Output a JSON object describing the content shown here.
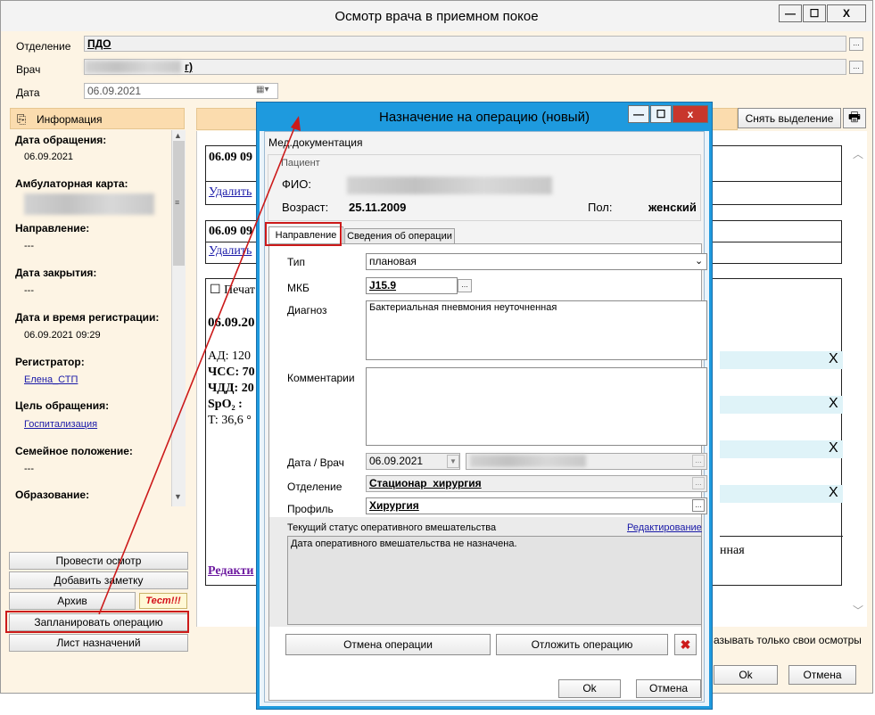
{
  "main_window": {
    "title": "Осмотр врача в приемном покое",
    "minimize_glyph": "—",
    "maximize_glyph": "☐",
    "close_glyph": "X",
    "fields": {
      "department_label": "Отделение",
      "department_value": "ПДО",
      "doctor_label": "Врач",
      "doctor_value_visible": "г)",
      "date_label": "Дата",
      "date_value": "06.09.2021"
    },
    "info_tab": "Информация",
    "left_panel": [
      {
        "label": "Дата обращения:",
        "value": "06.09.2021",
        "link": false
      },
      {
        "label": "Амбулаторная карта:",
        "value": "",
        "link": false
      },
      {
        "label": "Направление:",
        "value": "---",
        "link": false
      },
      {
        "label": "Дата закрытия:",
        "value": "---",
        "link": false
      },
      {
        "label": "Дата и время регистрации:",
        "value": "06.09.2021 09:29",
        "link": false
      },
      {
        "label": "Регистратор:",
        "value": "Елена_СТП",
        "link": true
      },
      {
        "label": "Цель обращения:",
        "value": "Госпитализация",
        "link": true
      },
      {
        "label": "Семейное положение:",
        "value": "---",
        "link": false
      },
      {
        "label": "Образование:",
        "value": "",
        "link": false
      }
    ],
    "buttons": {
      "conduct_exam": "Провести осмотр",
      "add_note": "Добавить заметку",
      "archive": "Архив",
      "test_badge": "Тест!!!",
      "plan_operation": "Запланировать операцию",
      "prescription_sheet": "Лист назначений",
      "clear_selection": "Снять выделение",
      "ok": "Ok",
      "cancel": "Отмена"
    },
    "show_own_only": "азывать только свои осмотры",
    "center": {
      "card1_title": "06.09 09",
      "card1_link": "Удалить",
      "card2_title": "06.09 09",
      "card2_link": "Удалить",
      "card3_check": "Печат",
      "card3_date": "06.09.20",
      "vitals": [
        "АД: 120",
        "ЧСС: 70",
        "ЧДД: 20",
        "SpO₂ :",
        "T: 36,6 °"
      ],
      "right_text": "нная",
      "edit_link": "Редакти",
      "x_mark": "X"
    }
  },
  "dialog": {
    "title": "Назначение на операцию (новый)",
    "minimize_glyph": "—",
    "maximize_glyph": "☐",
    "close_glyph": "x",
    "menu": "Мед.документация",
    "patient_group": "Пациент",
    "fio_label": "ФИО:",
    "age_label": "Возраст:",
    "age_value": "25.11.2009",
    "sex_label": "Пол:",
    "sex_value": "женский",
    "tabs": [
      "Направление",
      "Сведения об операции"
    ],
    "form": {
      "type_label": "Тип",
      "type_value": "плановая",
      "mkb_label": "МКБ",
      "mkb_value": "J15.9",
      "diagnosis_label": "Диагноз",
      "diagnosis_value": "Бактериальная пневмония неуточненная",
      "comment_label": "Комментарии",
      "comment_value": "",
      "date_doctor_label": "Дата / Врач",
      "date_value": "06.09.2021",
      "department_label": "Отделение",
      "department_value": "Стационар_хирургия",
      "profile_label": "Профиль",
      "profile_value": "Хирургия"
    },
    "status": {
      "label": "Текущий статус оперативного вмешательства",
      "edit_link": "Редактирование",
      "text": "Дата оперативного вмешательства не назначена."
    },
    "buttons": {
      "cancel_operation": "Отмена операции",
      "postpone_operation": "Отложить операцию",
      "ok": "Ok",
      "cancel": "Отмена"
    }
  },
  "colors": {
    "main_bg": "#fdf4e4",
    "dialog_frame": "#1e9ade",
    "close_red": "#c8372c",
    "highlight_red": "#cc1a1a",
    "link_blue": "#1a1aa8"
  }
}
